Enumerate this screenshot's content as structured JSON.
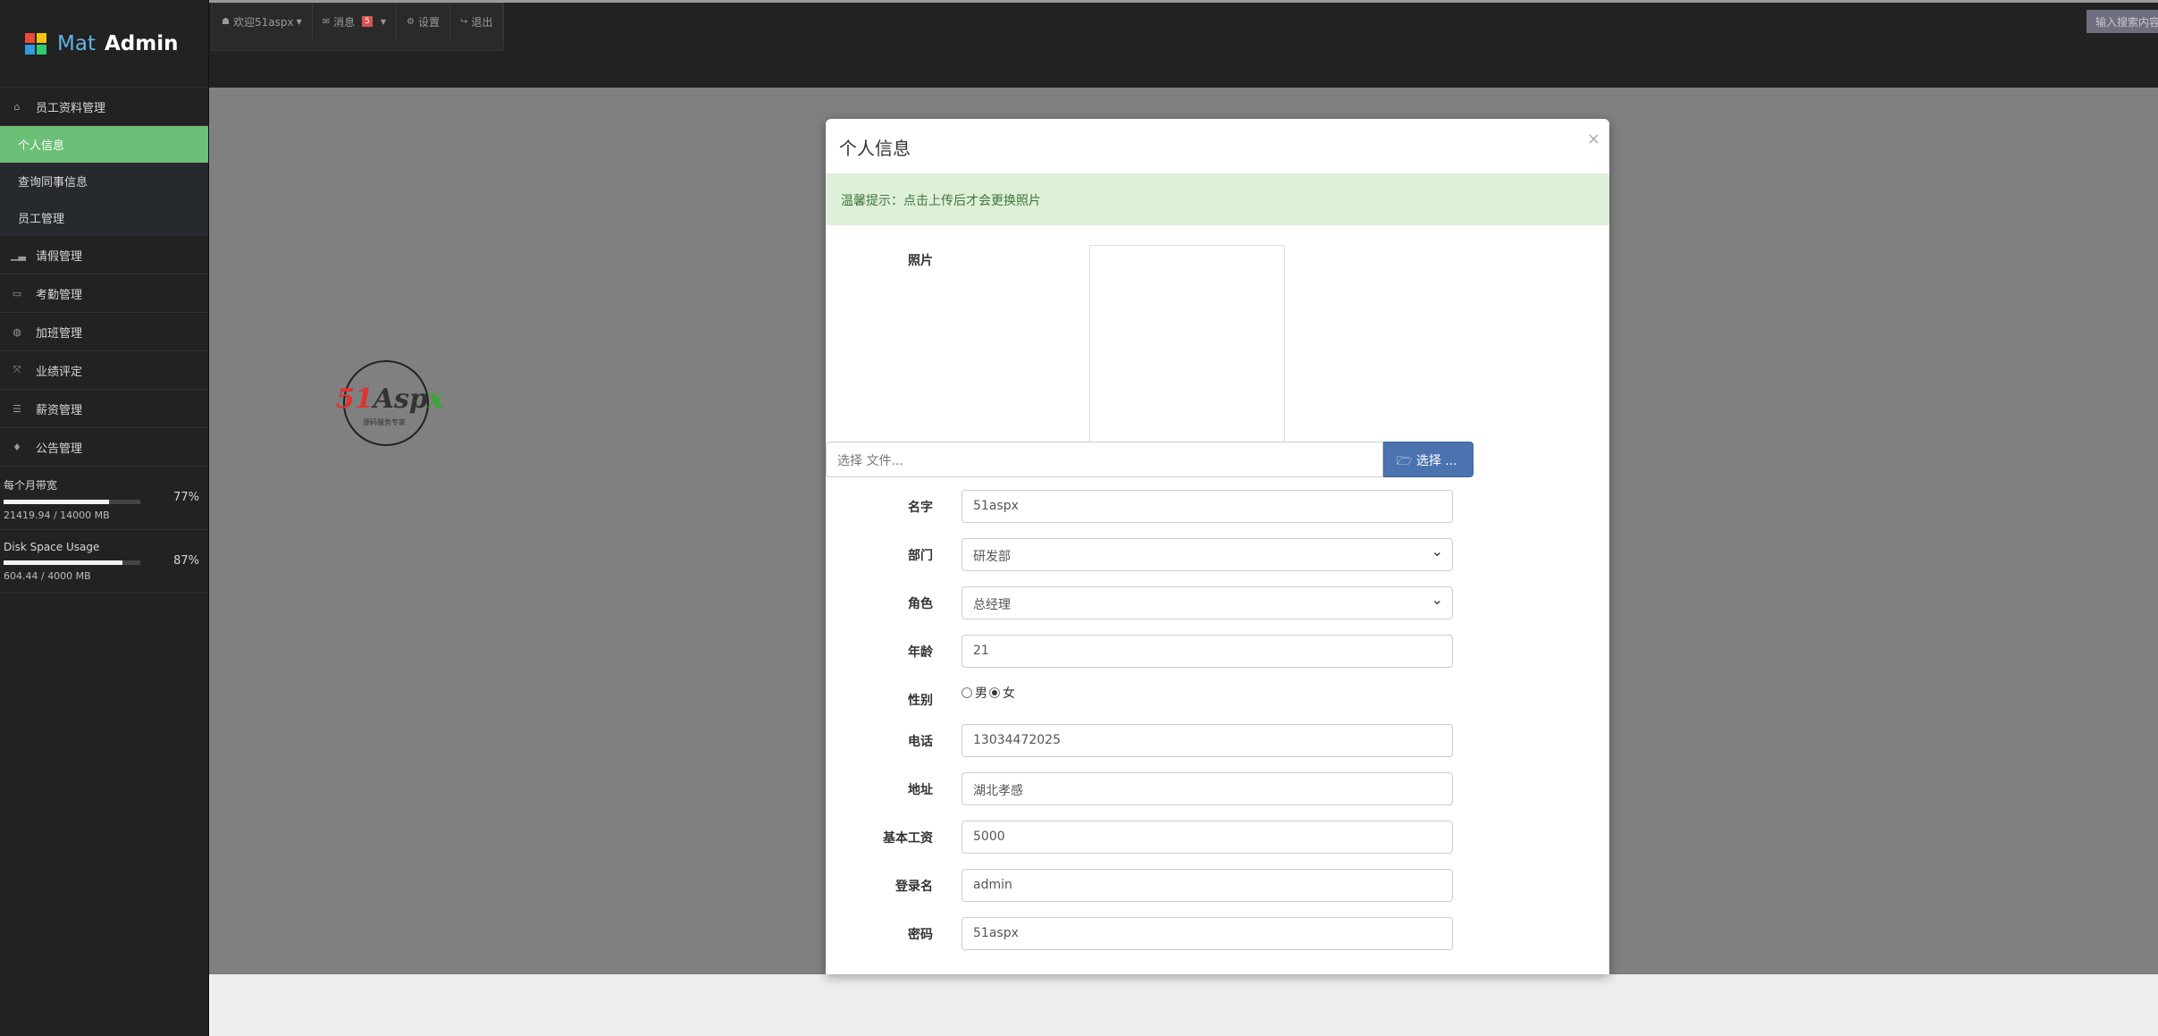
{
  "brand": {
    "mat": "Mat",
    "admin": "Admin",
    "logo_colors": [
      "#e74c3c",
      "#f1c40f",
      "#3498db",
      "#2ecc71"
    ]
  },
  "topbar": {
    "welcome": "欢迎51aspx",
    "messages": "消息",
    "message_count": "5",
    "settings": "设置",
    "logout": "退出",
    "search_placeholder": "输入搜索内容"
  },
  "sidebar": {
    "employee_mgmt": "员工资料管理",
    "sub_items": [
      "个人信息",
      "查询同事信息",
      "员工管理"
    ],
    "items": [
      "请假管理",
      "考勤管理",
      "加班管理",
      "业绩评定",
      "薪资管理",
      "公告管理"
    ],
    "usage": [
      {
        "label": "每个月带宽",
        "detail": "21419.94 / 14000 MB",
        "percent": "77%",
        "fraction": 0.77
      },
      {
        "label": "Disk Space Usage",
        "detail": "604.44 / 4000 MB",
        "percent": "87%",
        "fraction": 0.87
      }
    ]
  },
  "watermark": {
    "red": "51",
    "dark": "Asp",
    "green": "x",
    "tagline": "源码服务专家"
  },
  "modal": {
    "title": "个人信息",
    "close": "×",
    "alert": "温馨提示：点击上传后才会更换照片",
    "photo_label": "照片",
    "file_placeholder": "选择 文件...",
    "file_button": "选择 ...",
    "fields": {
      "name_label": "名字",
      "name_value": "51aspx",
      "dept_label": "部门",
      "dept_value": "研发部",
      "role_label": "角色",
      "role_value": "总经理",
      "age_label": "年龄",
      "age_value": "21",
      "gender_label": "性别",
      "gender_male": "男",
      "gender_female": "女",
      "phone_label": "电话",
      "phone_value": "13034472025",
      "address_label": "地址",
      "address_value": "湖北孝感",
      "salary_label": "基本工资",
      "salary_value": "5000",
      "login_label": "登录名",
      "login_value": "admin",
      "password_label": "密码",
      "password_value": "51aspx"
    }
  }
}
